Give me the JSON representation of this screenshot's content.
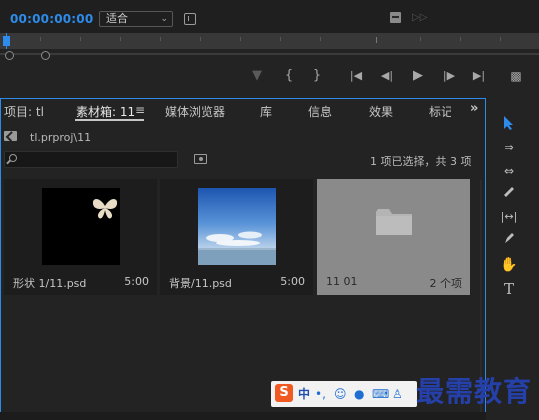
{
  "monitor": {
    "timecode": "00:00:00:00",
    "fit_value": "适合"
  },
  "project_panel": {
    "tabs": [
      {
        "label": "项目: tl",
        "active": false
      },
      {
        "label": "素材箱: 11",
        "active": true
      },
      {
        "label": "媒体浏览器",
        "active": false
      },
      {
        "label": "库",
        "active": false
      },
      {
        "label": "信息",
        "active": false
      },
      {
        "label": "效果",
        "active": false
      },
      {
        "label": "标记",
        "active": false
      }
    ],
    "tabs_more": "»",
    "tab_menu": "≡",
    "breadcrumb": "tl.prproj\\11",
    "search_placeholder": "",
    "selection_status": "1 项已选择，共 3 项",
    "items": [
      {
        "name": "形状 1/11.psd",
        "meta": "5:00",
        "thumb": "butterfly-on-black",
        "selected": false
      },
      {
        "name": "背景/11.psd",
        "meta": "5:00",
        "thumb": "blue-sky-sea",
        "selected": false
      },
      {
        "name": "11 01",
        "meta": "2 个项",
        "thumb": "folder",
        "selected": true
      }
    ]
  },
  "tools": [
    "selection-tool",
    "track-select-tool",
    "ripple-edit-tool",
    "razor-tool",
    "slip-tool",
    "pen-tool",
    "hand-tool",
    "type-tool"
  ],
  "ime": {
    "logo": "S",
    "mode": "中"
  },
  "watermark": "最需教育",
  "colors": {
    "accent": "#2d8ceb",
    "panel_bg": "#232323",
    "selected_item": "#8a8a8a",
    "watermark": "#2540a8"
  }
}
